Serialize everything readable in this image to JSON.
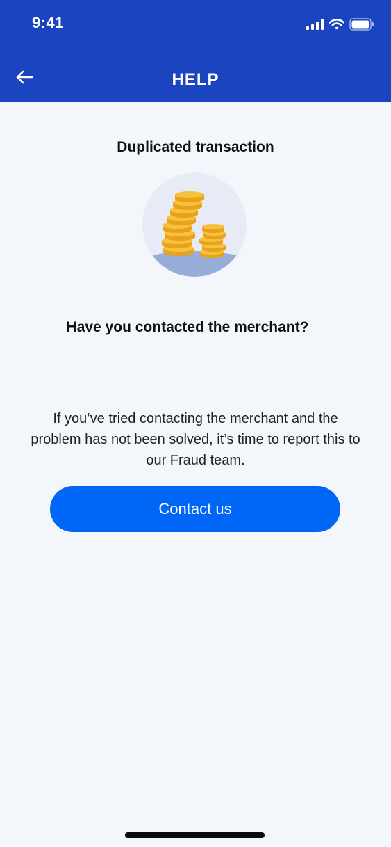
{
  "status_bar": {
    "time": "9:41",
    "icons": [
      "signal-icon",
      "wifi-icon",
      "battery-icon"
    ]
  },
  "header": {
    "title": "HELP",
    "back_icon": "back-arrow-icon",
    "background_color": "#1b45c0"
  },
  "content": {
    "section_title": "Duplicated transaction",
    "illustration": "coins-stack-illustration",
    "question": "Have you contacted the merchant?",
    "body_text": "If you’ve tried contacting the merchant and the problem has not been solved, it’s time to report this to our Fraud team."
  },
  "actions": {
    "contact_button_label": "Contact us",
    "contact_button_color": "#0066f5"
  }
}
